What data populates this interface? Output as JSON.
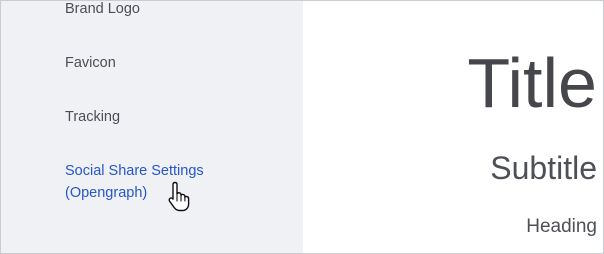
{
  "sidebar": {
    "items": [
      {
        "label": "Brand Logo"
      },
      {
        "label": "Favicon"
      },
      {
        "label": "Tracking"
      },
      {
        "label": "Social Share Settings (Opengraph)"
      }
    ]
  },
  "preview": {
    "title": "Title",
    "subtitle": "Subtitle",
    "heading": "Heading"
  },
  "colors": {
    "sidebar_bg": "#f0f1f4",
    "active_link": "#2656c9",
    "text": "#4b4e55"
  },
  "icons": [
    "hand-pointer-cursor-icon"
  ]
}
